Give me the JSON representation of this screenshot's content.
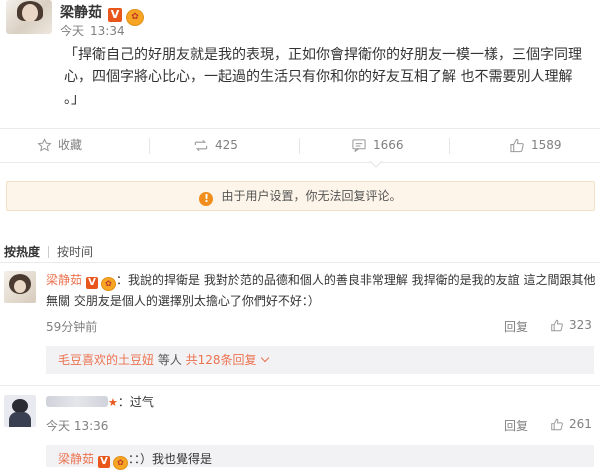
{
  "post": {
    "author": "梁静茹",
    "vip_badge": "V",
    "time_prefix": "今天",
    "time": "13:34",
    "text": "「捍衛自己的好朋友就是我的表現，正如你會捍衛你的好朋友一模一樣，三個字同理心，四個字將心比心，一起過的生活只有你和你的好友互相了解 也不需要別人理解 。」"
  },
  "actions": {
    "favorite": "收藏",
    "repost": "425",
    "comment": "1666",
    "like": "1589"
  },
  "notice": {
    "text": "由于用户设置，你无法回复评论。"
  },
  "sort": {
    "hot": "按热度",
    "time": "按时间"
  },
  "comments": [
    {
      "name": "梁静茹",
      "vip_badge": "V",
      "text": "：我說的捍衛是 我對於范的品德和個人的善良非常理解 我捍衛的是我的友誼 這之間跟其他無關 交朋友是個人的選擇別太擔心了你們好不好：）",
      "time": "59分钟前",
      "reply": "回复",
      "likes": "323",
      "sub_user": "毛豆喜欢的土豆妞",
      "sub_mid": " 等人 ",
      "sub_total": "共128条回复"
    },
    {
      "text": "：过气",
      "time": "今天 13:36",
      "reply": "回复",
      "likes": "261",
      "sub_user": "梁静茹",
      "sub_text": "：：）我也覺得是"
    }
  ],
  "colors": {
    "accent": "#eb7350",
    "vip": "#e8561c",
    "notice_bg": "#fdf5e9"
  }
}
